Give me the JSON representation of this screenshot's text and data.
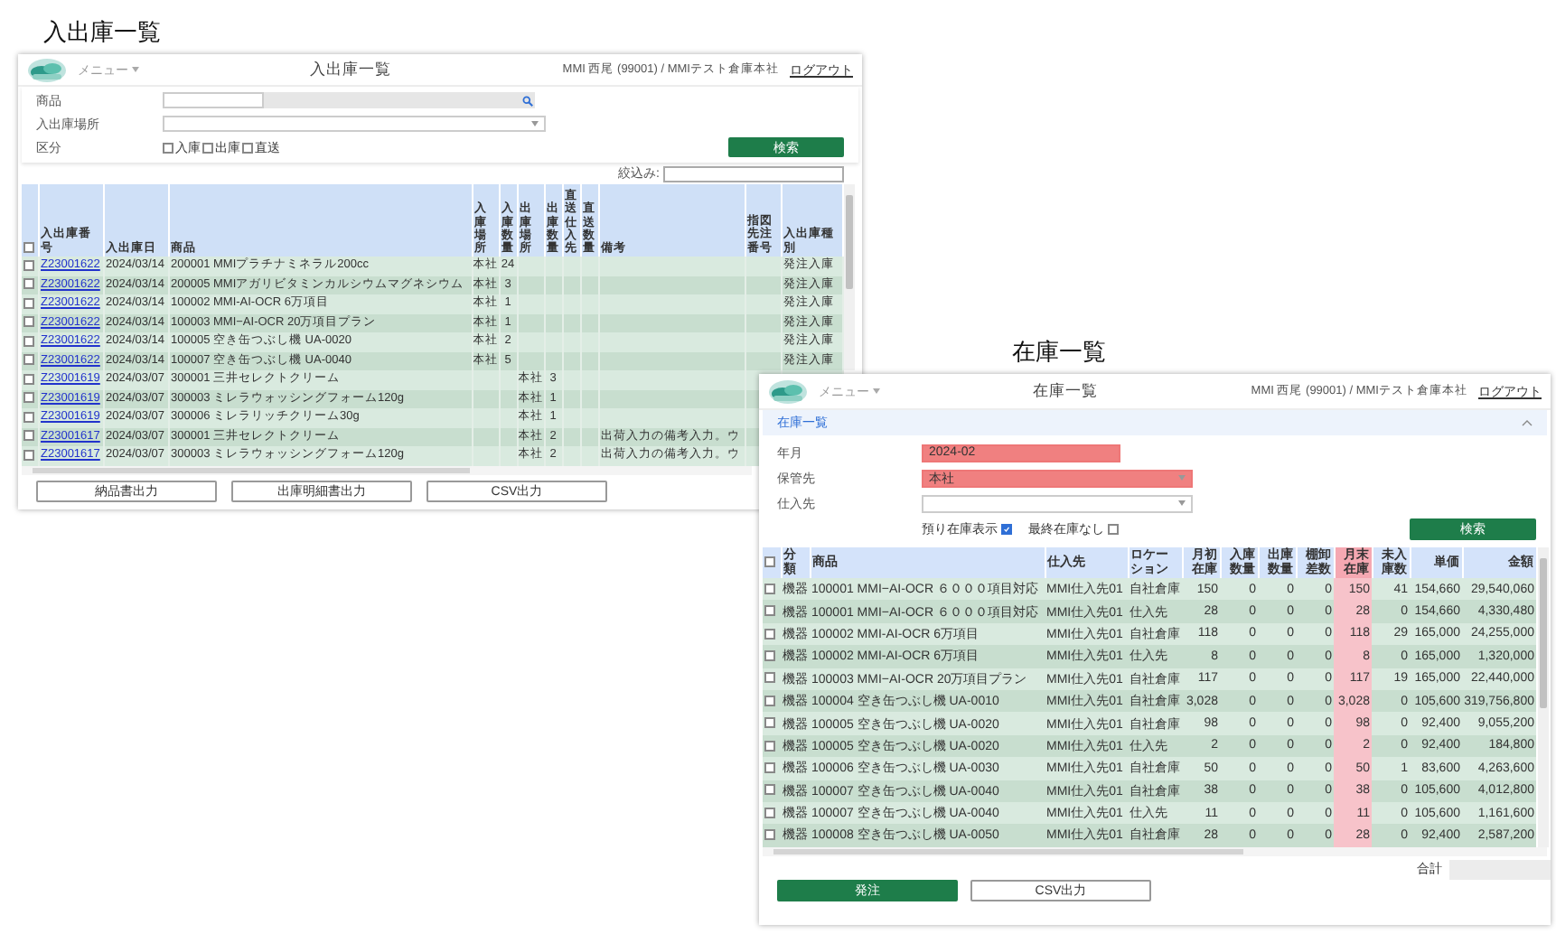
{
  "io_screen": {
    "caption": "入出庫一覧",
    "header": {
      "menu": "メニュー",
      "title": "入出庫一覧",
      "user": "MMI 西尾 (99001) / MMIテスト倉庫本社",
      "logout": "ログアウト"
    },
    "filters": {
      "product_label": "商品",
      "location_label": "入出庫場所",
      "category_label": "区分",
      "categories": [
        {
          "label": "入庫",
          "checked": false
        },
        {
          "label": "出庫",
          "checked": false
        },
        {
          "label": "直送",
          "checked": false
        }
      ],
      "search_button": "検索",
      "narrow_label": "絞込み:"
    },
    "table": {
      "all_checked": false,
      "columns": [
        {
          "label": "入出庫番号",
          "kind": "link"
        },
        {
          "label": "入出庫日",
          "kind": "text"
        },
        {
          "label": "商品",
          "kind": "text"
        },
        {
          "label": "入庫場所",
          "kind": "vertical"
        },
        {
          "label": "入庫数量",
          "kind": "vertical"
        },
        {
          "label": "出庫場所",
          "kind": "vertical"
        },
        {
          "label": "出庫数量",
          "kind": "vertical"
        },
        {
          "label": "直送仕入先",
          "kind": "vertical"
        },
        {
          "label": "直送数量",
          "kind": "vertical"
        },
        {
          "label": "備考",
          "kind": "text"
        },
        {
          "label": "指図先注番号",
          "kind": "text"
        },
        {
          "label": "入出庫種別",
          "kind": "text"
        }
      ],
      "rows": [
        {
          "checked": false,
          "cells": [
            "Z23001622",
            "2024/03/14",
            "200001 MMIプラチナミネラル200cc",
            "本社",
            "24",
            null,
            null,
            null,
            null,
            null,
            null,
            "発注入庫"
          ]
        },
        {
          "checked": false,
          "cells": [
            "Z23001622",
            "2024/03/14",
            "200005 MMIアガリビタミンカルシウムマグネシウム",
            "本社",
            "3",
            null,
            null,
            null,
            null,
            null,
            null,
            "発注入庫"
          ]
        },
        {
          "checked": false,
          "cells": [
            "Z23001622",
            "2024/03/14",
            "100002 MMI-AI-OCR 6万項目",
            "本社",
            "1",
            null,
            null,
            null,
            null,
            null,
            null,
            "発注入庫"
          ]
        },
        {
          "checked": false,
          "cells": [
            "Z23001622",
            "2024/03/14",
            "100003 MMI−AI-OCR 20万項目プラン",
            "本社",
            "1",
            null,
            null,
            null,
            null,
            null,
            null,
            "発注入庫"
          ]
        },
        {
          "checked": false,
          "cells": [
            "Z23001622",
            "2024/03/14",
            "100005 空き缶つぶし機 UA-0020",
            "本社",
            "2",
            null,
            null,
            null,
            null,
            null,
            null,
            "発注入庫"
          ]
        },
        {
          "checked": false,
          "cells": [
            "Z23001622",
            "2024/03/14",
            "100007 空き缶つぶし機 UA-0040",
            "本社",
            "5",
            null,
            null,
            null,
            null,
            null,
            null,
            "発注入庫"
          ]
        },
        {
          "checked": false,
          "cells": [
            "Z23001619",
            "2024/03/07",
            "300001 三井セレクトクリーム",
            null,
            null,
            "本社",
            "3",
            null,
            null,
            null,
            null,
            null
          ]
        },
        {
          "checked": false,
          "cells": [
            "Z23001619",
            "2024/03/07",
            "300003 ミレラウォッシングフォーム120g",
            null,
            null,
            "本社",
            "1",
            null,
            null,
            null,
            null,
            null
          ]
        },
        {
          "checked": false,
          "cells": [
            "Z23001619",
            "2024/03/07",
            "300006 ミレラリッチクリーム30g",
            null,
            null,
            "本社",
            "1",
            null,
            null,
            null,
            null,
            null
          ]
        },
        {
          "checked": false,
          "cells": [
            "Z23001617",
            "2024/03/07",
            "300001 三井セレクトクリーム",
            null,
            null,
            "本社",
            "2",
            null,
            null,
            "出荷入力の備考入力。ウ",
            null,
            null
          ]
        },
        {
          "checked": false,
          "cells": [
            "Z23001617",
            "2024/03/07",
            "300003 ミレラウォッシングフォーム120g",
            null,
            null,
            "本社",
            "2",
            null,
            null,
            "出荷入力の備考入力。ウ",
            null,
            null
          ]
        }
      ]
    },
    "buttons": [
      "納品書出力",
      "出庫明細書出力",
      "CSV出力"
    ]
  },
  "stock_screen": {
    "caption": "在庫一覧",
    "header": {
      "menu": "メニュー",
      "title": "在庫一覧",
      "user": "MMI 西尾 (99001) / MMIテスト倉庫本社",
      "logout": "ログアウト"
    },
    "section": {
      "title": "在庫一覧",
      "expanded": true
    },
    "filters": [
      {
        "label": "年月",
        "kind": "text",
        "value": "2024-02",
        "invalid": true
      },
      {
        "label": "保管先",
        "kind": "select",
        "value": "本社",
        "invalid": true
      },
      {
        "label": "仕入先",
        "kind": "select",
        "invalid": false
      }
    ],
    "options": [
      {
        "label": "預り在庫表示",
        "checked": true
      },
      {
        "label": "最終在庫なし",
        "checked": false
      }
    ],
    "search_button": "検索",
    "table": {
      "all_checked": false,
      "columns": [
        {
          "label": "分類",
          "kind": "text",
          "highlight": false
        },
        {
          "label": "商品",
          "kind": "text",
          "highlight": false
        },
        {
          "label": "仕入先",
          "kind": "text",
          "highlight": false
        },
        {
          "label": "ロケーション",
          "kind": "text",
          "highlight": false
        },
        {
          "label": "月初在庫",
          "kind": "number",
          "highlight": false
        },
        {
          "label": "入庫数量",
          "kind": "number",
          "highlight": false
        },
        {
          "label": "出庫数量",
          "kind": "number",
          "highlight": false
        },
        {
          "label": "棚卸差数",
          "kind": "number",
          "highlight": false
        },
        {
          "label": "月末在庫",
          "kind": "number",
          "highlight": true
        },
        {
          "label": "未入庫数",
          "kind": "number",
          "highlight": false
        },
        {
          "label": "単価",
          "kind": "number",
          "highlight": false
        },
        {
          "label": "金額",
          "kind": "number",
          "highlight": false
        }
      ],
      "rows": [
        {
          "checked": false,
          "cells": [
            "機器",
            "100001 MMI−AI-OCR ６０００項目対応",
            "MMI仕入先01",
            "自社倉庫",
            "150",
            "0",
            "0",
            "0",
            "150",
            "41",
            "154,660",
            "29,540,060"
          ]
        },
        {
          "checked": false,
          "cells": [
            "機器",
            "100001 MMI−AI-OCR ６０００項目対応",
            "MMI仕入先01",
            "仕入先",
            "28",
            "0",
            "0",
            "0",
            "28",
            "0",
            "154,660",
            "4,330,480"
          ]
        },
        {
          "checked": false,
          "cells": [
            "機器",
            "100002 MMI-AI-OCR 6万項目",
            "MMI仕入先01",
            "自社倉庫",
            "118",
            "0",
            "0",
            "0",
            "118",
            "29",
            "165,000",
            "24,255,000"
          ]
        },
        {
          "checked": false,
          "cells": [
            "機器",
            "100002 MMI-AI-OCR 6万項目",
            "MMI仕入先01",
            "仕入先",
            "8",
            "0",
            "0",
            "0",
            "8",
            "0",
            "165,000",
            "1,320,000"
          ]
        },
        {
          "checked": false,
          "cells": [
            "機器",
            "100003 MMI−AI-OCR 20万項目プラン",
            "MMI仕入先01",
            "自社倉庫",
            "117",
            "0",
            "0",
            "0",
            "117",
            "19",
            "165,000",
            "22,440,000"
          ]
        },
        {
          "checked": false,
          "cells": [
            "機器",
            "100004 空き缶つぶし機 UA-0010",
            "MMI仕入先01",
            "自社倉庫",
            "3,028",
            "0",
            "0",
            "0",
            "3,028",
            "0",
            "105,600",
            "319,756,800"
          ]
        },
        {
          "checked": false,
          "cells": [
            "機器",
            "100005 空き缶つぶし機 UA-0020",
            "MMI仕入先01",
            "自社倉庫",
            "98",
            "0",
            "0",
            "0",
            "98",
            "0",
            "92,400",
            "9,055,200"
          ]
        },
        {
          "checked": false,
          "cells": [
            "機器",
            "100005 空き缶つぶし機 UA-0020",
            "MMI仕入先01",
            "仕入先",
            "2",
            "0",
            "0",
            "0",
            "2",
            "0",
            "92,400",
            "184,800"
          ]
        },
        {
          "checked": false,
          "cells": [
            "機器",
            "100006 空き缶つぶし機 UA-0030",
            "MMI仕入先01",
            "自社倉庫",
            "50",
            "0",
            "0",
            "0",
            "50",
            "1",
            "83,600",
            "4,263,600"
          ]
        },
        {
          "checked": false,
          "cells": [
            "機器",
            "100007 空き缶つぶし機 UA-0040",
            "MMI仕入先01",
            "自社倉庫",
            "38",
            "0",
            "0",
            "0",
            "38",
            "0",
            "105,600",
            "4,012,800"
          ]
        },
        {
          "checked": false,
          "cells": [
            "機器",
            "100007 空き缶つぶし機 UA-0040",
            "MMI仕入先01",
            "仕入先",
            "11",
            "0",
            "0",
            "0",
            "11",
            "0",
            "105,600",
            "1,161,600"
          ]
        },
        {
          "checked": false,
          "cells": [
            "機器",
            "100008 空き缶つぶし機 UA-0050",
            "MMI仕入先01",
            "自社倉庫",
            "28",
            "0",
            "0",
            "0",
            "28",
            "0",
            "92,400",
            "2,587,200"
          ]
        }
      ]
    },
    "total_label": "合計",
    "buttons": [
      {
        "label": "発注",
        "kind": "primary"
      },
      {
        "label": "CSV出力",
        "kind": "secondary"
      }
    ]
  }
}
